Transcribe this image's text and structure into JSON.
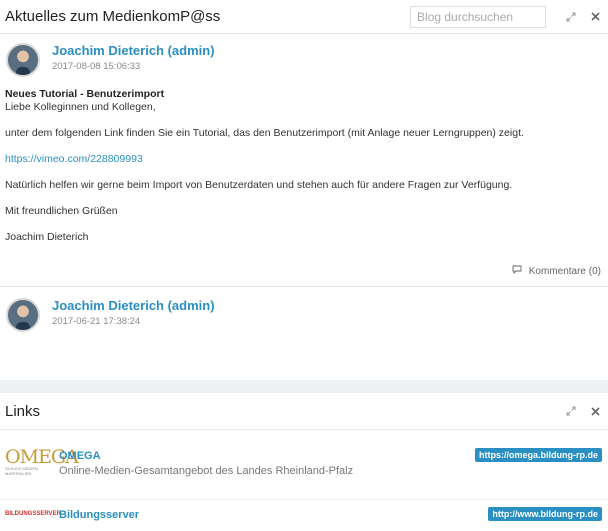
{
  "blog": {
    "title": "Aktuelles zum MedienkomP@ss",
    "search_placeholder": "Blog durchsuchen",
    "posts": [
      {
        "author": "Joachim Dieterich (admin)",
        "date": "2017-08-08 15:06:33",
        "title": "Neues Tutorial - Benutzerimport",
        "lines": [
          "Liebe Kolleginnen und Kollegen,",
          "unter dem folgenden Link finden Sie ein Tutorial, das den Benutzerimport (mit Anlage neuer Lerngruppen) zeigt.",
          "https://vimeo.com/228809993",
          "Natürlich helfen wir gerne beim Import von Benutzerdaten und stehen auch für andere Fragen zur Verfügung.",
          "Mit freundlichen Grüßen",
          "Joachim Dieterich"
        ],
        "comments": "Kommentare (0)"
      },
      {
        "author": "Joachim Dieterich (admin)",
        "date": "2017-06-21 17:38:24"
      }
    ]
  },
  "links": {
    "title": "Links",
    "items": [
      {
        "logo": "OMEGA",
        "logo_sub": "SCHULE MEDIEN MATERIALIEN",
        "name": "OMEGA",
        "description": "Online-Medien-Gesamtangebot des Landes Rheinland-Pfalz",
        "url": "https://omega.bildung-rp.de"
      },
      {
        "logo": "BILDUNGSSERVER",
        "name": "Bildungsserver",
        "url": "http://www.bildung-rp.de"
      }
    ]
  },
  "icons": {
    "expand": "expand-icon",
    "close": "close-icon",
    "comment": "comment-icon"
  },
  "colors": {
    "accent": "#2a8fc2",
    "background": "#eef1f4"
  }
}
